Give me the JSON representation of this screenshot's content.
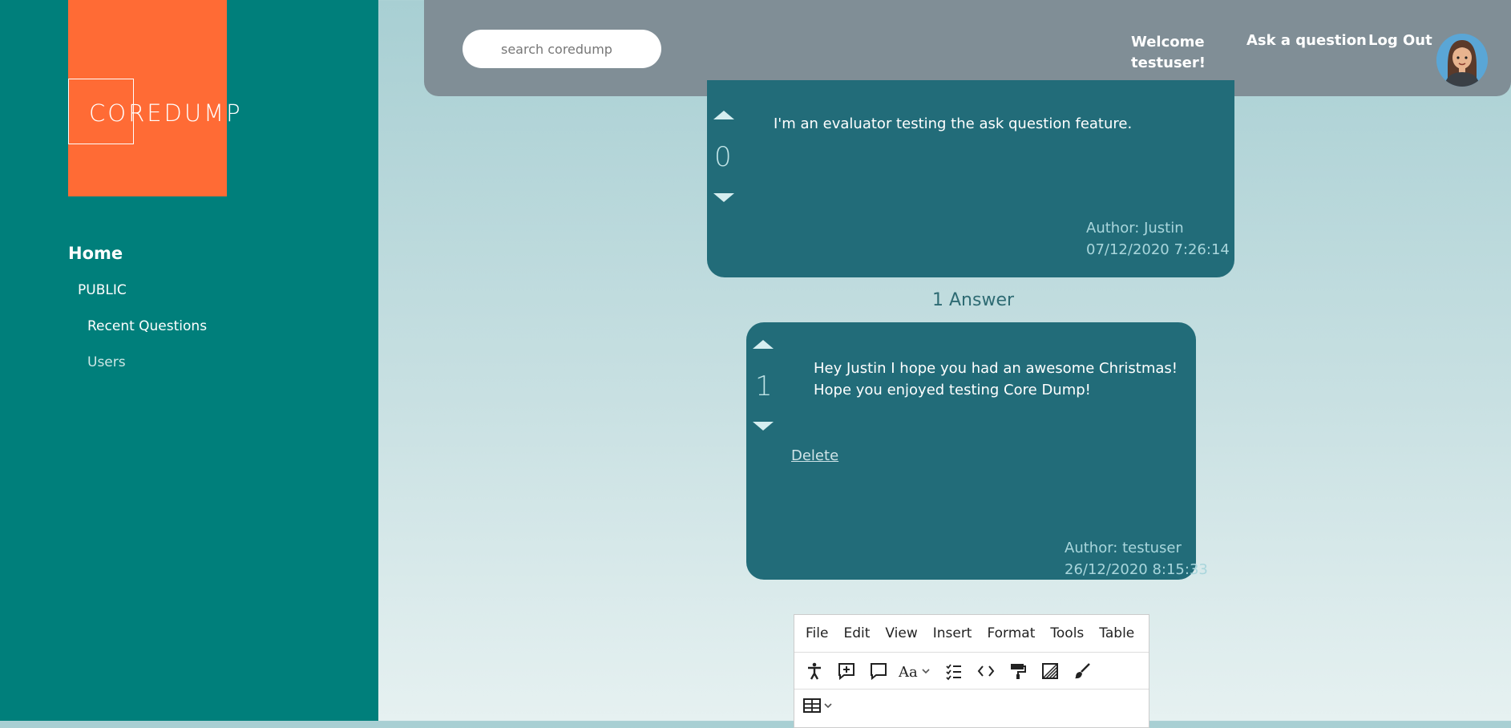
{
  "sidebar": {
    "logo_text": "COREDUMP",
    "home": "Home",
    "public": "PUBLIC",
    "recent_questions": "Recent Questions",
    "users": "Users"
  },
  "header": {
    "search_placeholder": "search coredump",
    "welcome_line1": "Welcome",
    "welcome_line2": "testuser!",
    "ask_question": "Ask a question",
    "log_out": "Log Out"
  },
  "question": {
    "score": "0",
    "body": "I'm an evaluator testing the ask question feature.",
    "author": "Author: Justin",
    "date": "07/12/2020 7:26:14"
  },
  "answers_count": "1 Answer",
  "answer": {
    "score": "1",
    "body_line1": "Hey Justin I hope you had an awesome Christmas!",
    "body_line2": "Hope you enjoyed testing Core Dump!",
    "delete": "Delete",
    "author": "Author: testuser",
    "date": "26/12/2020 8:15:33"
  },
  "editor": {
    "menu": [
      "File",
      "Edit",
      "View",
      "Insert",
      "Format",
      "Tools",
      "Table"
    ],
    "toolbar_icons": [
      "accessibility-icon",
      "add-comment-icon",
      "comment-icon",
      "text-style-icon",
      "checklist-icon",
      "code-icon",
      "format-painter-icon",
      "gradient-icon",
      "brush-icon",
      "table-icon"
    ]
  },
  "colors": {
    "sidebar": "#007f7b",
    "logo_bg": "#ff6b35",
    "header": "#808e96",
    "card": "#226c79"
  }
}
